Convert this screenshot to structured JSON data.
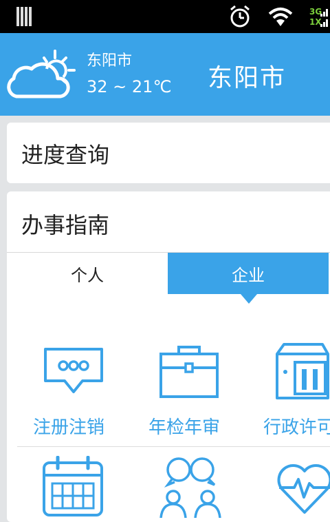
{
  "status_bar": {
    "network_top": "3G",
    "network_bottom": "1X"
  },
  "header": {
    "weather_city": "东阳市",
    "weather_temp": "32 ~ 21℃",
    "title": "东阳市",
    "icon": "partly-cloudy-icon"
  },
  "progress_query": {
    "title": "进度查询"
  },
  "guide": {
    "title": "办事指南",
    "tabs": [
      {
        "label": "个人",
        "active": false
      },
      {
        "label": "企业",
        "active": true
      }
    ],
    "items": [
      {
        "label": "注册注销",
        "icon": "chat-bubble-icon"
      },
      {
        "label": "年检年审",
        "icon": "briefcase-icon"
      },
      {
        "label": "行政许可",
        "icon": "building-icon"
      },
      {
        "label": "",
        "icon": "calendar-icon"
      },
      {
        "label": "",
        "icon": "people-icon"
      },
      {
        "label": "",
        "icon": "heart-pulse-icon"
      }
    ]
  },
  "colors": {
    "accent": "#3aa3e8",
    "status_bar": "#000000",
    "background": "#e2e4e6",
    "network": "#7ccf3c"
  }
}
